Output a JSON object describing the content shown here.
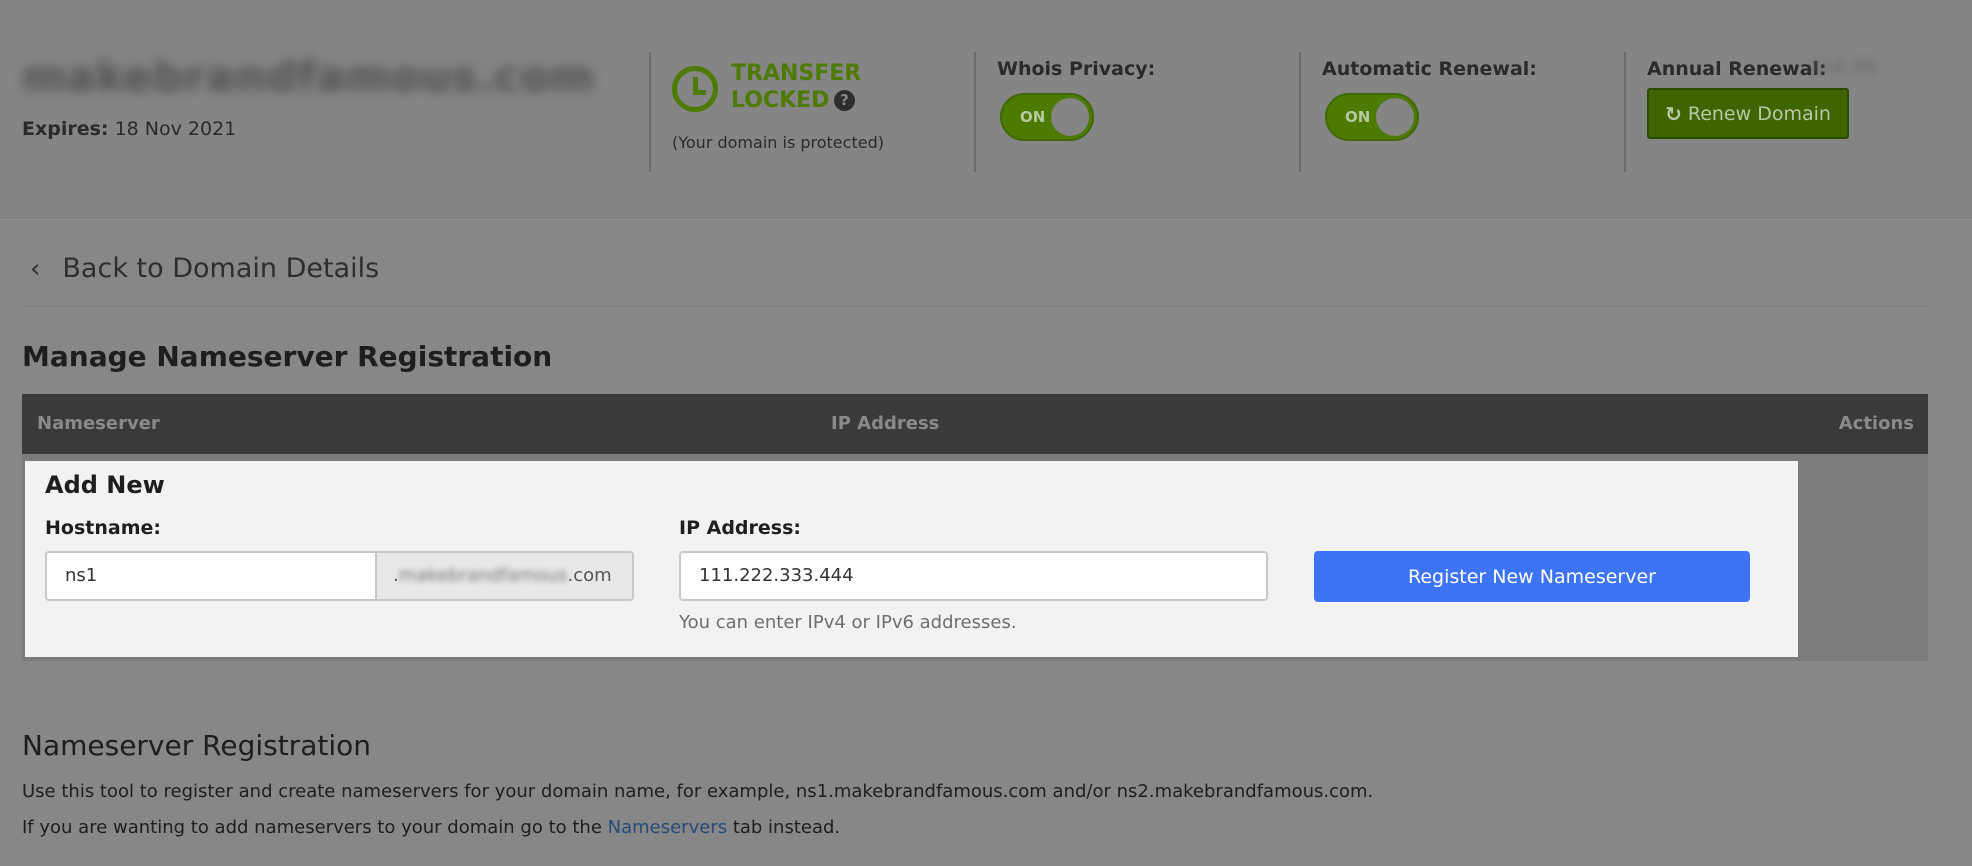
{
  "header": {
    "domain_name": "makebrandfamous.com",
    "expires_label": "Expires:",
    "expires_value": "18 Nov 2021",
    "transfer_line1": "TRANSFER",
    "transfer_line2": "LOCKED",
    "transfer_sub": "(Your domain is protected)",
    "whois_label": "Whois Privacy:",
    "whois_toggle": "ON",
    "auto_renew_label": "Automatic Renewal:",
    "auto_renew_toggle": "ON",
    "annual_label": "Annual Renewal:",
    "annual_value": "$18.99",
    "renew_button": "Renew Domain"
  },
  "back_link": "Back to Domain Details",
  "section_title": "Manage Nameserver Registration",
  "table": {
    "columns": [
      "Nameserver",
      "IP Address",
      "Actions"
    ]
  },
  "add_new": {
    "title": "Add New",
    "hostname_label": "Hostname:",
    "hostname_value": "ns1",
    "hostname_suffix_prefix": ".",
    "hostname_suffix_blur": "makebrandfamous",
    "hostname_suffix_end": ".com",
    "ip_label": "IP Address:",
    "ip_value": "111.222.333.444",
    "ip_hint": "You can enter IPv4 or IPv6 addresses.",
    "register_button": "Register New Nameserver"
  },
  "info": {
    "title": "Nameserver Registration",
    "line1": "Use this tool to register and create nameservers for your domain name, for example, ns1.makebrandfamous.com and/or ns2.makebrandfamous.com.",
    "line2_pre": "If you are wanting to add nameservers to your domain go to the ",
    "line2_link": "Nameservers",
    "line2_post": " tab instead."
  },
  "colors": {
    "overlay_bg": "#878787",
    "green": "#4d7a00",
    "primary_button": "#3d73f5",
    "table_header": "#3a3a3c"
  }
}
